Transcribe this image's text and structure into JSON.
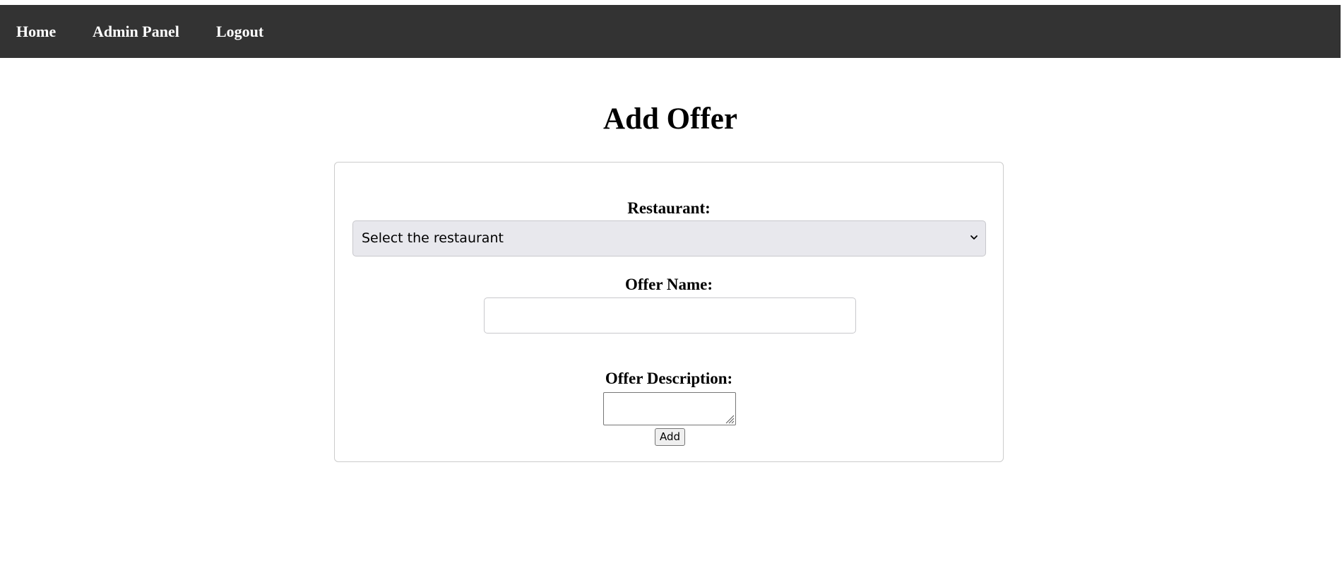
{
  "nav": {
    "items": [
      {
        "label": "Home"
      },
      {
        "label": "Admin Panel"
      },
      {
        "label": "Logout"
      }
    ],
    "background": "#333333",
    "text_color": "#ffffff"
  },
  "page": {
    "title": "Add Offer"
  },
  "form": {
    "restaurant": {
      "label": "Restaurant:",
      "selected_value": "Select the restaurant",
      "icon": "chevron-down-icon"
    },
    "offer_name": {
      "label": "Offer Name:",
      "value": "",
      "placeholder": ""
    },
    "offer_description": {
      "label": "Offer Description:",
      "value": "",
      "icon": "resize-handle-icon"
    },
    "submit_label": "Add"
  },
  "colors": {
    "select_background": "#e8e8ed",
    "card_border": "#cccccc"
  }
}
